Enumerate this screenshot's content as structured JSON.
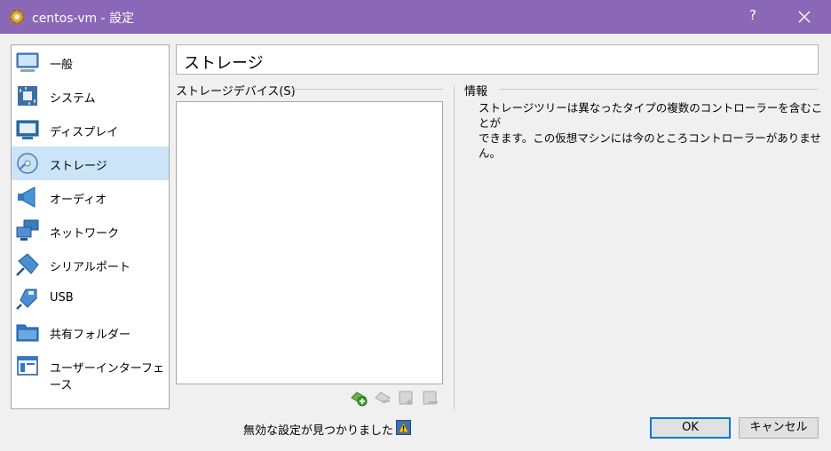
{
  "window": {
    "title": "centos-vm - 設定",
    "help_label": "?"
  },
  "sidebar": {
    "items": [
      {
        "label": "一般",
        "icon": "general-monitor-icon"
      },
      {
        "label": "システム",
        "icon": "system-chip-icon"
      },
      {
        "label": "ディスプレイ",
        "icon": "display-monitor-icon"
      },
      {
        "label": "ストレージ",
        "icon": "storage-disk-icon",
        "selected": true
      },
      {
        "label": "オーディオ",
        "icon": "audio-speaker-icon"
      },
      {
        "label": "ネットワーク",
        "icon": "network-icon"
      },
      {
        "label": "シリアルポート",
        "icon": "serial-port-icon"
      },
      {
        "label": "USB",
        "icon": "usb-icon"
      },
      {
        "label": "共有フォルダー",
        "icon": "shared-folder-icon"
      },
      {
        "label": "ユーザーインターフェース",
        "icon": "user-interface-icon"
      }
    ]
  },
  "page": {
    "title": "ストレージ"
  },
  "storage_devices": {
    "caption": "ストレージデバイス(S)",
    "tools": [
      "add-controller-icon",
      "remove-controller-icon",
      "add-attachment-icon",
      "remove-attachment-icon"
    ]
  },
  "info": {
    "caption": "情報",
    "line1": "ストレージツリーは異なったタイプの複数のコントローラーを含むことが",
    "line2": "できます。この仮想マシンには今のところコントローラーがありません。"
  },
  "footer": {
    "status": "無効な設定が見つかりました",
    "ok_label": "OK",
    "cancel_label": "キャンセル"
  },
  "colors": {
    "titlebar": "#8b67b8",
    "selected_item": "#cce4f7",
    "default_button_border": "#0078d7"
  }
}
